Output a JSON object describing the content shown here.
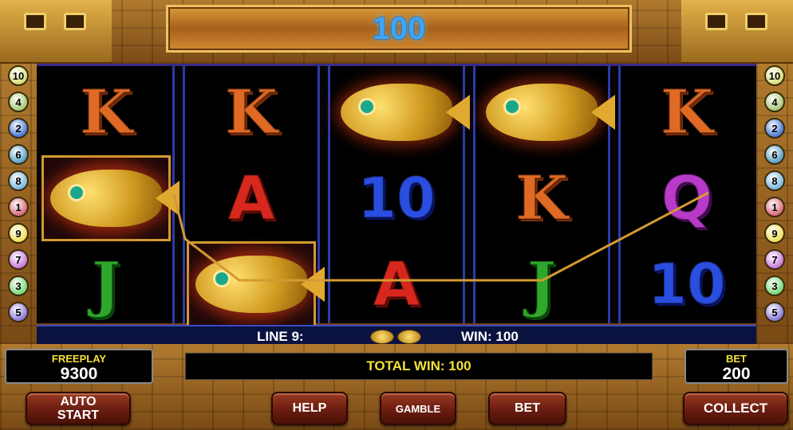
{
  "header": {
    "win_amount": "100"
  },
  "reels": [
    [
      "K",
      "fish",
      "J"
    ],
    [
      "K",
      "A",
      "fish"
    ],
    [
      "fish",
      "10",
      "A"
    ],
    [
      "fish",
      "K",
      "J"
    ],
    [
      "K",
      "Q",
      "10"
    ]
  ],
  "paylines": {
    "left": [
      "10",
      "4",
      "2",
      "6",
      "8",
      "1",
      "9",
      "7",
      "3",
      "5"
    ],
    "right": [
      "10",
      "4",
      "2",
      "6",
      "8",
      "1",
      "9",
      "7",
      "3",
      "5"
    ],
    "colors": {
      "10": "#d8e07a",
      "4": "#a8c878",
      "2": "#4a7ad8",
      "6": "#5aa0c8",
      "8": "#7ab8e0",
      "1": "#d86a7a",
      "9": "#f0e05a",
      "7": "#c87ad8",
      "3": "#7ad87a",
      "5": "#8a7ad8"
    }
  },
  "line_info": {
    "line_label": "LINE 9:",
    "win_label": "WIN: 100"
  },
  "freeplay": {
    "label": "FREEPLAY",
    "value": "9300"
  },
  "bet": {
    "label": "BET",
    "value": "200"
  },
  "total_win": "TOTAL WIN: 100",
  "buttons": {
    "auto_start": "AUTO\nSTART",
    "help": "HELP",
    "gamble": "GAMBLE",
    "bet": "BET",
    "collect": "COLLECT"
  },
  "colors": {
    "win_digits": "#3aa6ff",
    "label_yellow": "#f4e23a",
    "win_line": "#d49a30"
  }
}
